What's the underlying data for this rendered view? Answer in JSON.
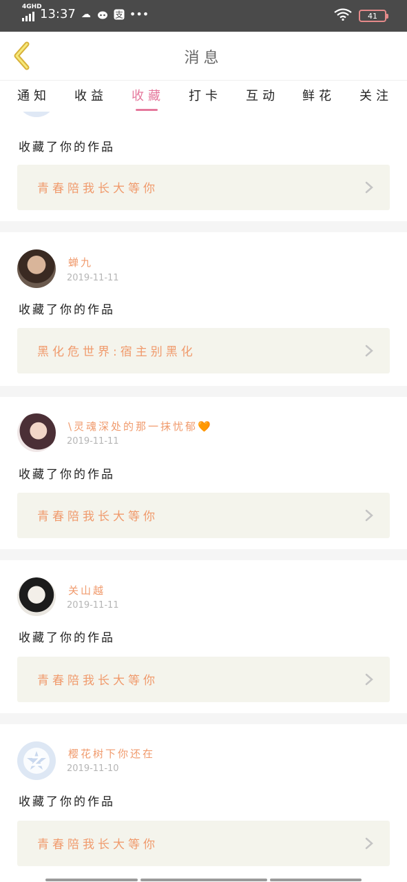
{
  "status_bar": {
    "network": "4GHD",
    "time": "13:37",
    "battery": "41",
    "icons": [
      "signal-icon",
      "cloud-icon",
      "cat-icon",
      "alipay-icon",
      "more-dots-icon",
      "wifi-icon",
      "battery-icon"
    ]
  },
  "header": {
    "title": "消息",
    "back_icon": "chevron-left-icon"
  },
  "tabs": [
    {
      "label": "通知"
    },
    {
      "label": "收益"
    },
    {
      "label": "收藏"
    },
    {
      "label": "打卡"
    },
    {
      "label": "互动"
    },
    {
      "label": "鲜花"
    },
    {
      "label": "关注"
    }
  ],
  "active_tab": "收藏",
  "colors": {
    "accent": "#e5789c",
    "name": "#f09a6c",
    "work_bg": "#f4f4ec"
  },
  "items": [
    {
      "name": "",
      "date": "",
      "action": "收藏了你的作品",
      "work": "青春陪我长大等你"
    },
    {
      "name": "蝉九",
      "date": "2019-11-11",
      "action": "收藏了你的作品",
      "work": "黑化危世界:宿主别黑化"
    },
    {
      "name": "\\灵魂深处的那一抹忧郁",
      "name_suffix": "🧡",
      "date": "2019-11-11",
      "action": "收藏了你的作品",
      "work": "青春陪我长大等你"
    },
    {
      "name": "关山越",
      "date": "2019-11-11",
      "action": "收藏了你的作品",
      "work": "青春陪我长大等你"
    },
    {
      "name": "樱花树下你还在",
      "date": "2019-11-10",
      "action": "收藏了你的作品",
      "work": "青春陪我长大等你"
    }
  ]
}
